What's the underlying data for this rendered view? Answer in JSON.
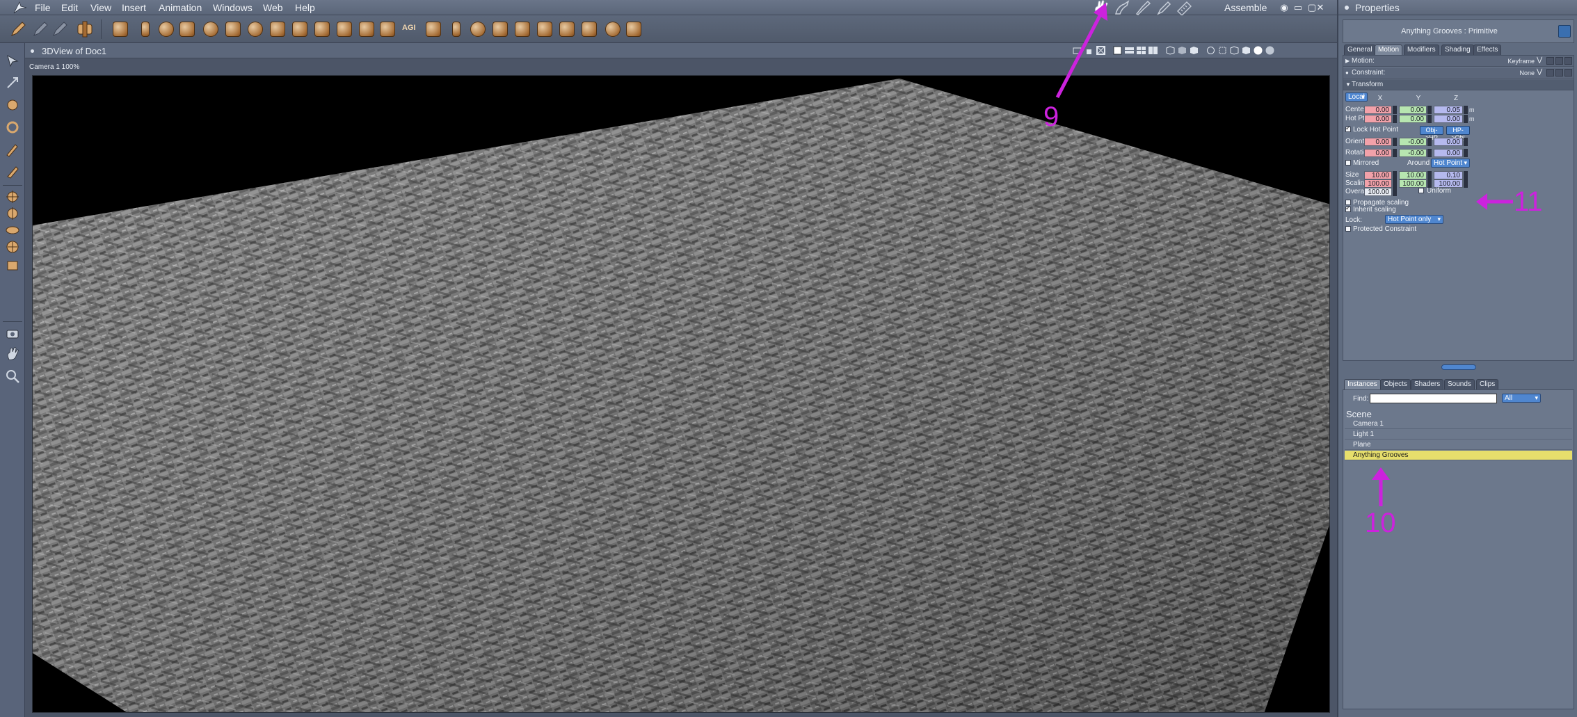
{
  "menubar": {
    "items": [
      "File",
      "Edit",
      "View",
      "Insert",
      "Animation",
      "Windows",
      "Web",
      "Help"
    ],
    "room_label": "Assemble",
    "window_controls": [
      "eye-icon",
      "minimize-icon",
      "maximize-icon",
      "close-icon"
    ]
  },
  "toolbar": {
    "text_tool": "AGI"
  },
  "view": {
    "title": "3DView of Doc1",
    "camera_label": "Camera 1 100%"
  },
  "properties": {
    "title": "Properties",
    "object_name": "Anything Grooves : Primitive",
    "tabs": [
      "General",
      "Motion",
      "Modifiers",
      "Shading",
      "Effects"
    ],
    "active_tab": "Motion",
    "motion_label": "Motion:",
    "motion_value": "Keyframe",
    "constraint_label": "Constraint:",
    "constraint_value": "None",
    "transform_label": "Transform",
    "space_dropdown": "Local",
    "axes": [
      "X",
      "Y",
      "Z"
    ],
    "center": {
      "label": "Center",
      "x": "0.00",
      "y": "0.00",
      "z": "0.05",
      "unit": "m"
    },
    "hotpoint": {
      "label": "Hot Pt.",
      "x": "0.00",
      "y": "0.00",
      "z": "0.00",
      "unit": "m"
    },
    "lock_hot_point": "Lock Hot Point",
    "obj_hp_button": "Obj->HP",
    "hp_obj_button": "HP->Obj",
    "orient": {
      "label": "Orient.",
      "x": "0.00",
      "y": "-0.00",
      "z": "0.00"
    },
    "rotation": {
      "label": "Rotation",
      "x": "0.00",
      "y": "-0.00",
      "z": "0.00"
    },
    "mirrored_label": "Mirrored",
    "around_label": "Around",
    "around_value": "Hot Point",
    "size": {
      "label": "Size",
      "x": "10.00",
      "y": "10.00",
      "z": "0.10"
    },
    "scaling": {
      "label": "Scaling",
      "x": "100.00",
      "y": "100.00",
      "z": "100.00"
    },
    "overall": {
      "label": "Overall",
      "value": "100.00"
    },
    "uniform_label": "Uniform",
    "propagate_scaling": "Propagate scaling",
    "inherit_scaling": "Inherit scaling",
    "lock_label": "Lock:",
    "lock_value": "Hot Point only",
    "protected_constraint": "Protected Constraint"
  },
  "instances": {
    "tabs": [
      "Instances",
      "Objects",
      "Shaders",
      "Sounds",
      "Clips"
    ],
    "active_tab": "Instances",
    "find_label": "Find:",
    "find_value": "",
    "filter_value": "All",
    "scene_label": "Scene",
    "items": [
      "Camera 1",
      "Light 1",
      "Plane",
      "Anything Grooves"
    ],
    "selected_item": "Anything Grooves"
  },
  "annotations": {
    "label_9": "9",
    "label_10": "10",
    "label_11": "11",
    "color": "#cc22dd"
  },
  "colors": {
    "selected_row": "#e6de6c",
    "x_field": "#f2a1a9",
    "y_field": "#b7e6b0",
    "z_field": "#b5b9ee",
    "accent_blue": "#4f86cf"
  }
}
